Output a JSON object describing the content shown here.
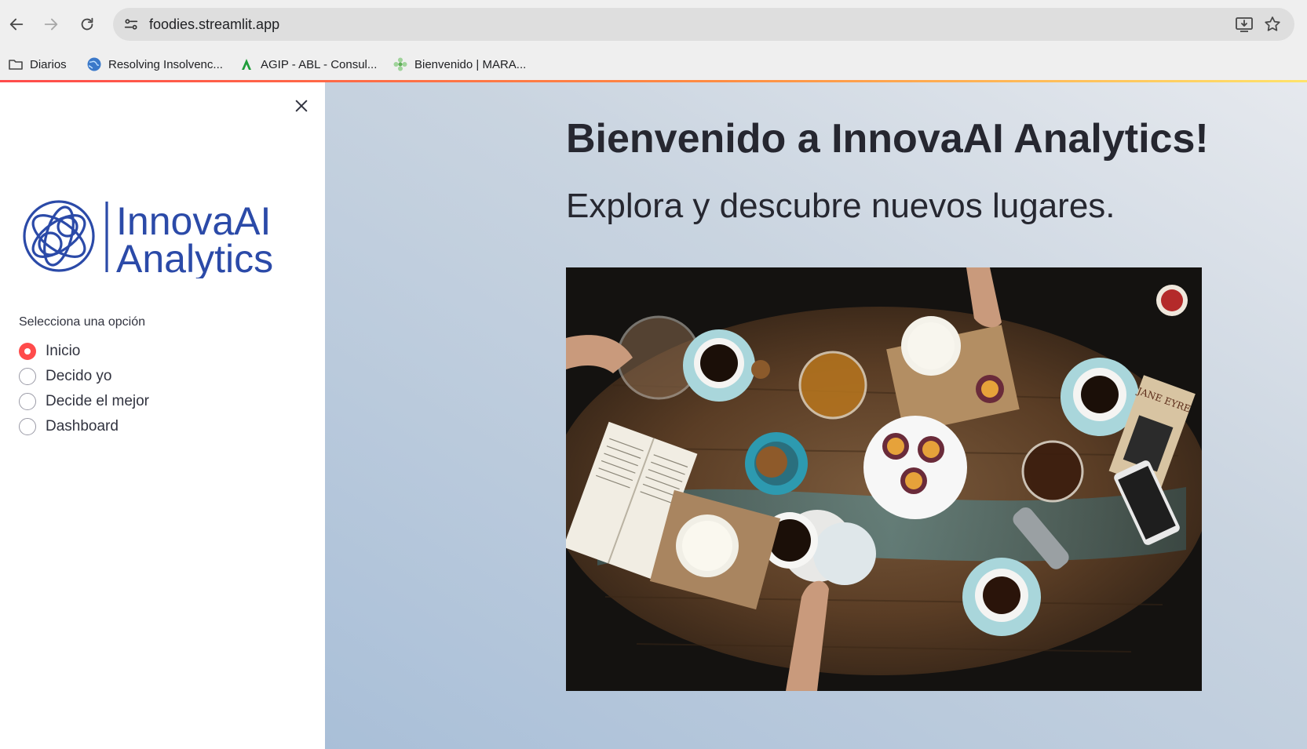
{
  "browser": {
    "url": "foodies.streamlit.app",
    "bookmarks": [
      {
        "label": "Diarios",
        "icon": "folder-icon"
      },
      {
        "label": "Resolving Insolvenc...",
        "icon": "globe-icon"
      },
      {
        "label": "AGIP - ABL - Consul...",
        "icon": "agip-icon"
      },
      {
        "label": "Bienvenido | MARA...",
        "icon": "flower-icon"
      }
    ]
  },
  "sidebar": {
    "logo_line1": "InnovaAI",
    "logo_line2": "Analytics",
    "radio_label": "Selecciona una opción",
    "options": [
      {
        "label": "Inicio",
        "selected": true
      },
      {
        "label": "Decido yo",
        "selected": false
      },
      {
        "label": "Decide el mejor",
        "selected": false
      },
      {
        "label": "Dashboard",
        "selected": false
      }
    ]
  },
  "main": {
    "title": "Bienvenido a InnovaAI Analytics!",
    "subtitle": "Explora y descubre nuevos lugares.",
    "book_cover": "JANE EYRE"
  },
  "colors": {
    "accent": "#ff4b4b",
    "text": "#262730",
    "logo_blue": "#2b4aa8"
  }
}
